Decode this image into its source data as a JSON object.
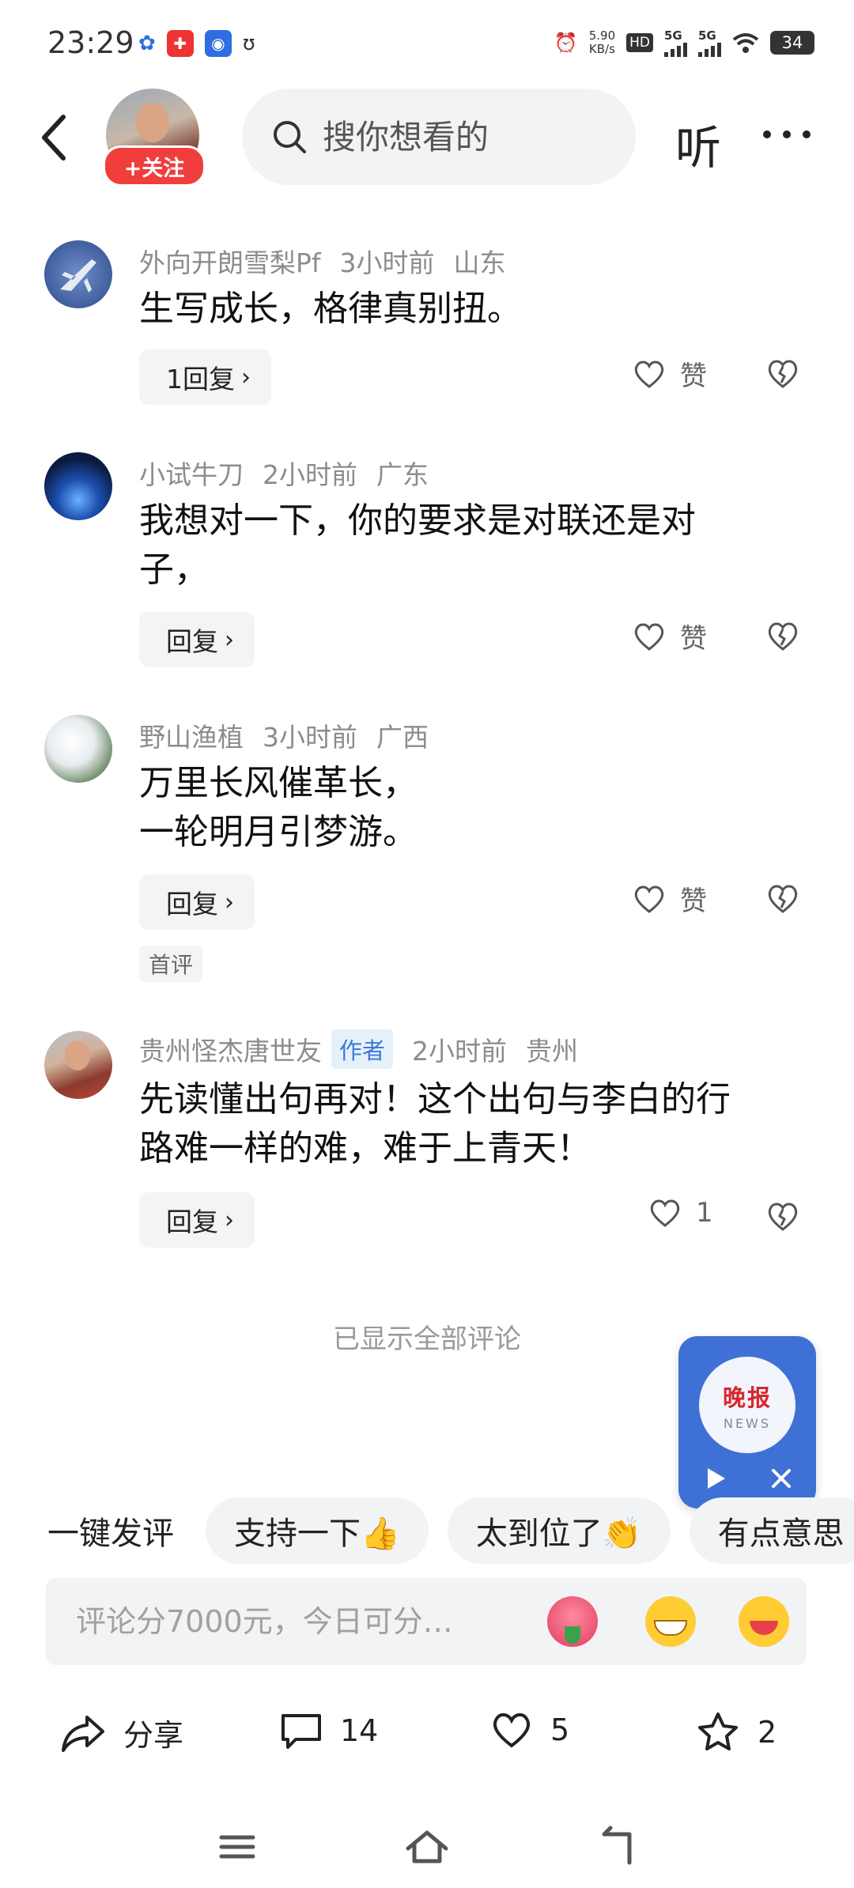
{
  "status_bar": {
    "time": "23:29",
    "net_speed_value": "5.90",
    "net_speed_unit": "KB/s",
    "hd_label": "HD",
    "sim1_label": "5G",
    "sim2_label": "5G",
    "battery": "34"
  },
  "header": {
    "follow_label": "+关注",
    "search_placeholder": "搜你想看的",
    "listen_label": "听"
  },
  "comments": [
    {
      "user": "外向开朗雪梨Pf",
      "time": "3小时前",
      "location": "山东",
      "lines": [
        "生写成长，格律真别扭。"
      ],
      "reply_label": "1回复",
      "like_label": "赞"
    },
    {
      "user": "小试牛刀",
      "time": "2小时前",
      "location": "广东",
      "lines": [
        "我想对一下，你的要求是对联还是对",
        "子，"
      ],
      "reply_label": "回复",
      "like_label": "赞"
    },
    {
      "user": "野山渔植",
      "time": "3小时前",
      "location": "广西",
      "lines": [
        "万里长风催革长，",
        "一轮明月引梦游。"
      ],
      "reply_label": "回复",
      "like_label": "赞",
      "tag": "首评"
    },
    {
      "user": "贵州怪杰唐世友",
      "author_tag": "作者",
      "time": "2小时前",
      "location": "贵州",
      "lines": [
        "先读懂出句再对！这个出句与李白的行",
        "路难一样的难，难于上青天！"
      ],
      "reply_label": "回复",
      "like_label": "1"
    }
  ],
  "all_shown": "已显示全部评论",
  "widget": {
    "line1": "晚报",
    "line2": "NEWS"
  },
  "quick_comments": {
    "label": "一键发评",
    "chips": [
      "支持一下👍",
      "太到位了👏",
      "有点意思"
    ]
  },
  "comment_input": {
    "placeholder": "评论分7000元，今日可分…"
  },
  "actions": {
    "share_label": "分享",
    "comment_count": "14",
    "like_count": "5",
    "favorite_count": "2"
  },
  "colors": {
    "follow_red": "#f23d3d",
    "widget_blue": "#3f70d6",
    "author_tag_blue": "#3a7bd5"
  }
}
